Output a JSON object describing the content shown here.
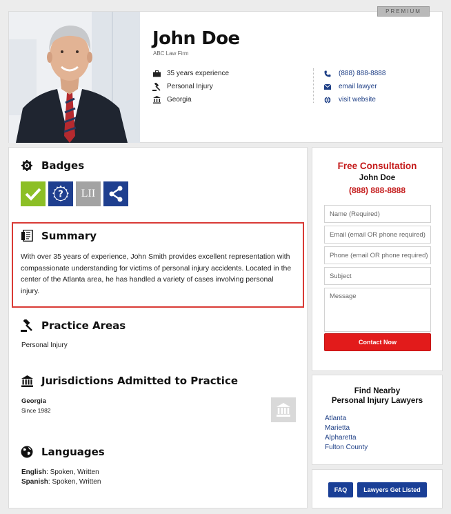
{
  "header": {
    "premium_label": "PREMIUM",
    "name": "John Doe",
    "firm": "ABC Law Firm",
    "info": [
      {
        "icon": "briefcase-icon",
        "text": "35 years experience"
      },
      {
        "icon": "gavel-icon",
        "text": "Personal Injury"
      },
      {
        "icon": "courthouse-icon",
        "text": "Georgia"
      }
    ],
    "contact": [
      {
        "icon": "phone-icon",
        "text": "(888) 888-8888"
      },
      {
        "icon": "envelope-icon",
        "text": "email lawyer"
      },
      {
        "icon": "globe-icon",
        "text": "visit website"
      }
    ]
  },
  "main": {
    "badges_title": "Badges",
    "badges": [
      {
        "icon": "checkmark-icon",
        "color": "#8cbf26"
      },
      {
        "icon": "question-gear-icon",
        "color": "#1f3f8f"
      },
      {
        "icon": "lii-icon",
        "label": "LII",
        "color": "#a3a3a3"
      },
      {
        "icon": "share-icon",
        "color": "#1f3f8f"
      }
    ],
    "summary_title": "Summary",
    "summary_text": "With over 35 years of experience, John Smith provides excellent representation with compassionate understanding for victims of personal injury accidents. Located in the center of the Atlanta area, he has handled a variety of cases involving personal injury.",
    "practice_title": "Practice Areas",
    "practice_text": "Personal Injury",
    "jurisdictions_title": "Jurisdictions Admitted to Practice",
    "jurisdiction_state": "Georgia",
    "jurisdiction_since": "Since 1982",
    "languages_title": "Languages",
    "languages": [
      {
        "lang": "English",
        "detail": ": Spoken, Written"
      },
      {
        "lang": "Spanish",
        "detail": ": Spoken, Written"
      }
    ]
  },
  "consult": {
    "title": "Free Consultation",
    "name": "John Doe",
    "phone": "(888) 888-8888",
    "name_placeholder": "Name (Required)",
    "email_placeholder": "Email (email OR phone required)",
    "phone_placeholder": "Phone (email OR phone required)",
    "subject_placeholder": "Subject",
    "message_placeholder": "Message",
    "button_label": "Contact Now"
  },
  "nearby": {
    "title_line1": "Find Nearby",
    "title_line2": "Personal Injury Lawyers",
    "links": [
      "Atlanta",
      "Marietta",
      "Alpharetta",
      "Fulton County"
    ]
  },
  "footer": {
    "faq_label": "FAQ",
    "listed_label": "Lawyers Get Listed"
  },
  "colors": {
    "accent_red": "#c41a1a",
    "link_blue": "#1e3f86",
    "button_red": "#e21b1b",
    "button_blue": "#1a3f96"
  }
}
